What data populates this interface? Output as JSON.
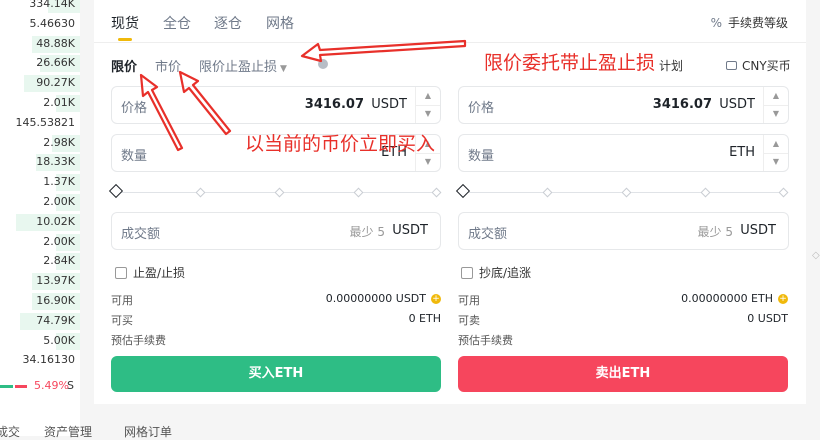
{
  "order_book": {
    "rows": [
      "334.14K",
      "5.46630",
      "48.88K",
      "26.66K",
      "90.27K",
      "2.01K",
      "145.53821",
      "2.98K",
      "18.33K",
      "1.37K",
      "2.00K",
      "10.02K",
      "2.00K",
      "2.84K",
      "13.97K",
      "16.90K",
      "74.79K",
      "5.00K",
      "34.16130"
    ],
    "bar_fractions": [
      0.4,
      0.0,
      0.6,
      0.5,
      0.7,
      0.3,
      0.0,
      0.35,
      0.55,
      0.3,
      0.3,
      0.8,
      0.3,
      0.3,
      0.6,
      0.6,
      0.75,
      0.3,
      0.0
    ],
    "change_pct": "5.49%",
    "suffix": "S"
  },
  "tabs": [
    "现货",
    "全仓",
    "逐仓",
    "网格"
  ],
  "active_tab": "现货",
  "fee_label": "手续费等级",
  "order_types": {
    "limit": "限价",
    "market": "市价",
    "stop_limit": "限价止盈止损"
  },
  "plan_label": "计划",
  "cny_label": "CNY买币",
  "buy_form": {
    "price_label": "价格",
    "price_value": "3416.07",
    "price_unit": "USDT",
    "qty_label": "数量",
    "qty_unit": "ETH",
    "total_label": "成交额",
    "total_hint": "最少 5",
    "total_unit": "USDT",
    "check_label": "止盈/止损",
    "avail_label": "可用",
    "avail_value": "0.00000000 USDT",
    "can_label": "可买",
    "can_value": "0 ETH",
    "fee_label": "预估手续费",
    "button": "买入ETH"
  },
  "sell_form": {
    "price_label": "价格",
    "price_value": "3416.07",
    "price_unit": "USDT",
    "qty_label": "数量",
    "qty_unit": "ETH",
    "total_label": "成交额",
    "total_hint": "最少 5",
    "total_unit": "USDT",
    "check_label": "抄底/追涨",
    "avail_label": "可用",
    "avail_value": "0.00000000 ETH",
    "can_label": "可卖",
    "can_value": "0 USDT",
    "fee_label": "预估手续费",
    "button": "卖出ETH"
  },
  "bottom_tabs": [
    "成交",
    "资产管理",
    "网格订单"
  ],
  "annotations": {
    "top_right": "限价委托带止盈止损",
    "middle": "以当前的币价立即买入"
  },
  "colors": {
    "buy": "#2ebd85",
    "sell": "#f6465d",
    "accent": "#f0b90b",
    "annotation": "#e8302a"
  }
}
